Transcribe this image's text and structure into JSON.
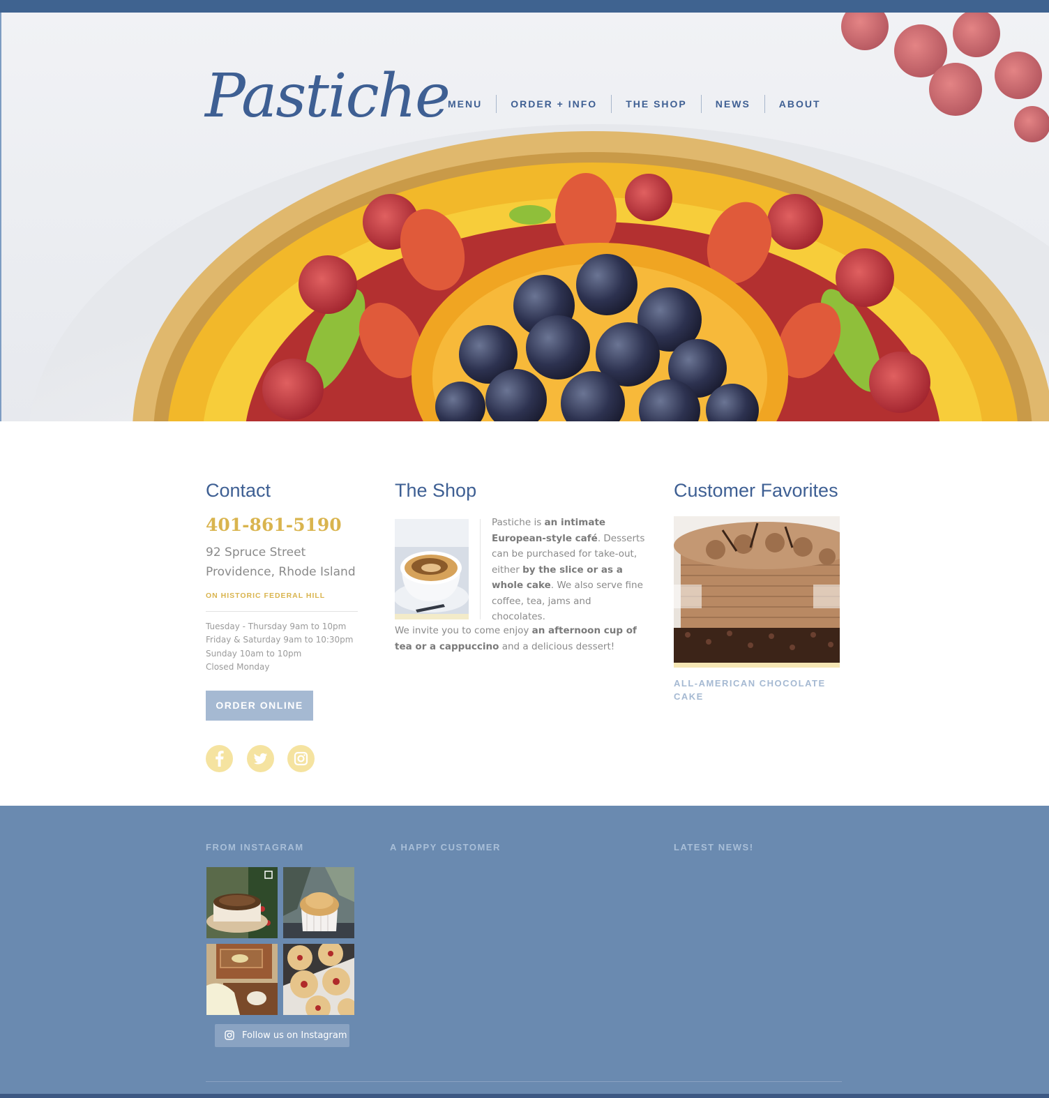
{
  "brand": {
    "logo": "Pastiche"
  },
  "nav": {
    "items": [
      "MENU",
      "ORDER + INFO",
      "THE SHOP",
      "NEWS",
      "ABOUT"
    ]
  },
  "contact": {
    "title": "Contact",
    "phone": "401-861-5190",
    "address_line1": "92 Spruce Street",
    "address_line2": "Providence, Rhode Island",
    "tagline": "ON HISTORIC FEDERAL HILL",
    "hours": [
      "Tuesday - Thursday 9am to 10pm",
      "Friday & Saturday 9am to 10:30pm",
      "Sunday 10am to 10pm",
      "Closed Monday"
    ],
    "order_button": "ORDER ONLINE",
    "social": [
      "facebook-icon",
      "twitter-icon",
      "instagram-icon"
    ]
  },
  "shop": {
    "title": "The Shop",
    "p1": [
      {
        "t": "Pastiche is ",
        "b": false
      },
      {
        "t": "an intimate European-style café",
        "b": true
      },
      {
        "t": ". Desserts can be purchased for take-out, either ",
        "b": false
      },
      {
        "t": "by the slice or as a whole cake",
        "b": true
      },
      {
        "t": ". We also serve fine coffee, tea, jams and chocolates.",
        "b": false
      }
    ],
    "p2": [
      {
        "t": "We invite you to come enjoy ",
        "b": false
      },
      {
        "t": "an afternoon cup of tea or a cappuccino",
        "b": true
      },
      {
        "t": " and a delicious dessert!",
        "b": false
      }
    ]
  },
  "favorites": {
    "title": "Customer Favorites",
    "caption": "ALL-AMERICAN CHOCOLATE CAKE"
  },
  "footer": {
    "instagram_title": "FROM INSTAGRAM",
    "customer_title": "A HAPPY CUSTOMER",
    "news_title": "LATEST NEWS!",
    "follow_button": "Follow us on Instagram"
  },
  "colors": {
    "brand_blue": "#3e5f93",
    "accent_gold": "#d9b44e",
    "footer_bg": "#6a8ab0",
    "button_bg": "#a5b9d2"
  }
}
